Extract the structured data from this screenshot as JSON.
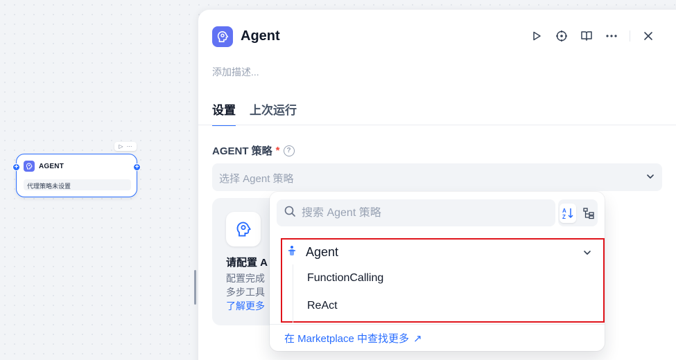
{
  "canvas": {
    "node": {
      "title": "AGENT",
      "status": "代理策略未设置",
      "toolbar_run_icon": "play-icon",
      "toolbar_more_icon": "more-icon"
    }
  },
  "panel": {
    "icon": "agent-brain-icon",
    "title": "Agent",
    "description_placeholder": "添加描述...",
    "actions": [
      "play-icon",
      "locate-icon",
      "book-icon",
      "more-icon",
      "close-icon"
    ],
    "tabs": [
      {
        "label": "设置",
        "active": true
      },
      {
        "label": "上次运行",
        "active": false
      }
    ],
    "field": {
      "label": "AGENT 策略",
      "required_mark": "*",
      "help_icon": "?",
      "select_placeholder": "选择 Agent 策略"
    },
    "info_card": {
      "title": "请配置 A",
      "body_line1": "配置完成",
      "body_line2": "多步工具",
      "link": "了解更多"
    }
  },
  "dropdown": {
    "search_placeholder": "搜索 Agent 策略",
    "group": {
      "name": "Agent",
      "items": [
        "FunctionCalling",
        "ReAct"
      ]
    },
    "footer_link": "在 Marketplace 中查找更多",
    "footer_arrow": "↗",
    "highlight_color": "#e0141b"
  },
  "colors": {
    "accent": "#296dff",
    "agent_icon_bg": "#6172f3",
    "required": "#f04438"
  }
}
